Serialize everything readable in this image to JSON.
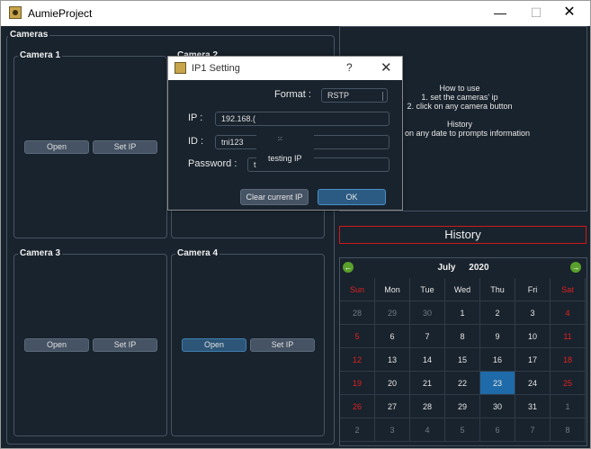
{
  "window": {
    "title": "AumieProject",
    "min": "—",
    "max": "☐",
    "close": "✕"
  },
  "cameras": {
    "group_title": "Cameras",
    "cam1": {
      "title": "Camera 1",
      "open": "Open",
      "set_ip": "Set IP"
    },
    "cam2": {
      "title": "Camera 2"
    },
    "cam3": {
      "title": "Camera 3",
      "open": "Open",
      "set_ip": "Set IP"
    },
    "cam4": {
      "title": "Camera 4",
      "open": "Open",
      "set_ip": "Set IP"
    }
  },
  "howto": {
    "heading": "How to use",
    "step1": "1. set the cameras' ip",
    "step2": "2. click on any camera button",
    "history_heading": "History",
    "history_text": "ting on any date to prompts information"
  },
  "history": {
    "label": "History"
  },
  "calendar": {
    "month": "July",
    "year": "2020",
    "prev": "←",
    "next": "→",
    "weekdays": [
      "Sun",
      "Mon",
      "Tue",
      "Wed",
      "Thu",
      "Fri",
      "Sat"
    ],
    "weeks": [
      [
        "28",
        "29",
        "30",
        "1",
        "2",
        "3",
        "4"
      ],
      [
        "5",
        "6",
        "7",
        "8",
        "9",
        "10",
        "11"
      ],
      [
        "12",
        "13",
        "14",
        "15",
        "16",
        "17",
        "18"
      ],
      [
        "19",
        "20",
        "21",
        "22",
        "23",
        "24",
        "25"
      ],
      [
        "26",
        "27",
        "28",
        "29",
        "30",
        "31",
        "1"
      ],
      [
        "2",
        "3",
        "4",
        "5",
        "6",
        "7",
        "8"
      ]
    ],
    "selected": "23",
    "weekend_color": "#e02020",
    "selected_color": "#1f6aa8"
  },
  "dialog": {
    "title": "IP1 Setting",
    "help": "?",
    "close": "✕",
    "format_label": "Format :",
    "format_value": "RSTP",
    "ip_label": "IP :",
    "ip_value": "192.168.(",
    "id_label": "ID :",
    "id_value": "tni123",
    "password_label": "Password :",
    "password_value": "tı",
    "tooltip": "testing IP",
    "clear_button": "Clear current IP",
    "ok_button": "OK"
  }
}
